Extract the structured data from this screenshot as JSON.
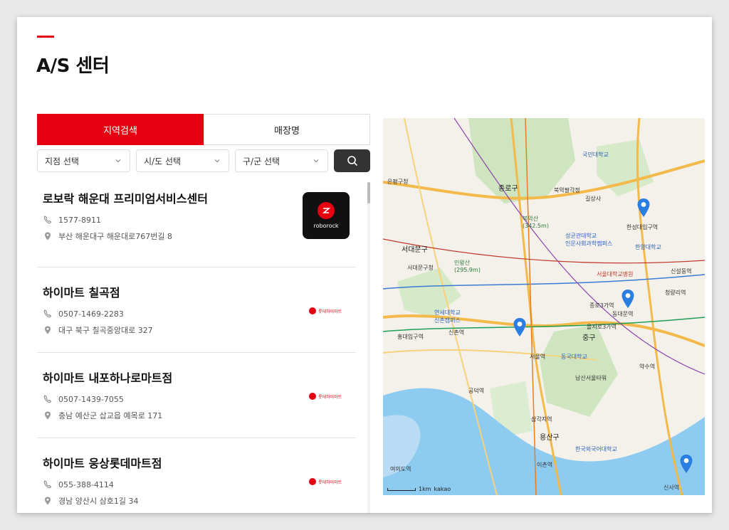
{
  "page": {
    "title": "A/S 센터"
  },
  "tabs": [
    {
      "label": "지역검색",
      "active": true
    },
    {
      "label": "매장명",
      "active": false
    }
  ],
  "filters": {
    "branch": "지점 선택",
    "city": "시/도 선택",
    "district": "구/군 선택"
  },
  "stores": [
    {
      "name": "로보락 해운대 프리미엄서비스센터",
      "phone": "1577-8911",
      "address": "부산 해운대구 해운대로767번길 8",
      "logo": "roborock",
      "logo_text": "roborock"
    },
    {
      "name": "하이마트 칠곡점",
      "phone": "0507-1469-2283",
      "address": "대구 북구 칠곡중앙대로 327",
      "logo": "lotte-himart",
      "logo_text": "롯데하이마트"
    },
    {
      "name": "하이마트 내포하나로마트점",
      "phone": "0507-1439-7055",
      "address": "충남 예산군 삽교읍 예목로 171",
      "logo": "lotte-himart",
      "logo_text": "롯데하이마트"
    },
    {
      "name": "하이마트 웅상롯데마트점",
      "phone": "055-388-4114",
      "address": "경남 양산시 삼호1길 34",
      "logo": "lotte-himart",
      "logo_text": "롯데하이마트"
    }
  ],
  "map": {
    "labels": {
      "jongno": "종로구",
      "seodaemun": "서대문구",
      "seodaemun_office": "서대문구청",
      "eunpyeong": "은평구청",
      "junggu": "중구",
      "yongsan": "용산구",
      "bukak": "북악산\n(342.5m)",
      "gilsangsa": "길상사",
      "inwang": "인왕산\n(295.9m)",
      "namsan": "남산서울타워",
      "bugaksan_park": "북악팔각정",
      "seoul_station": "서울역",
      "jongno3": "종로3가역",
      "sinchon": "신촌역",
      "hongik": "홍대입구역",
      "euljiro": "을지로3가역",
      "hanyang": "한양대학교",
      "hanseong": "한성대입구역",
      "yeouido": "여의도역",
      "ichon": "이촌역",
      "sinsa": "신사역",
      "snu_hosp": "서울대학교병원",
      "yonsei": "연세대학교\n신촌캠퍼스",
      "kookmin": "국민대학교",
      "sungkyunkwan": "성균관대학교\n인문사회과학캠퍼스",
      "dongguk": "동국대학교",
      "hufs": "한국외국어대학교",
      "sinseol": "신설동역",
      "cheongnyangni": "청량리역",
      "gongdeok": "공덕역",
      "samgakji": "삼각지역",
      "yaksu": "약수역",
      "dongdaemun": "동대문역"
    },
    "footer_scale": "1km",
    "footer_brand": "kakao"
  }
}
